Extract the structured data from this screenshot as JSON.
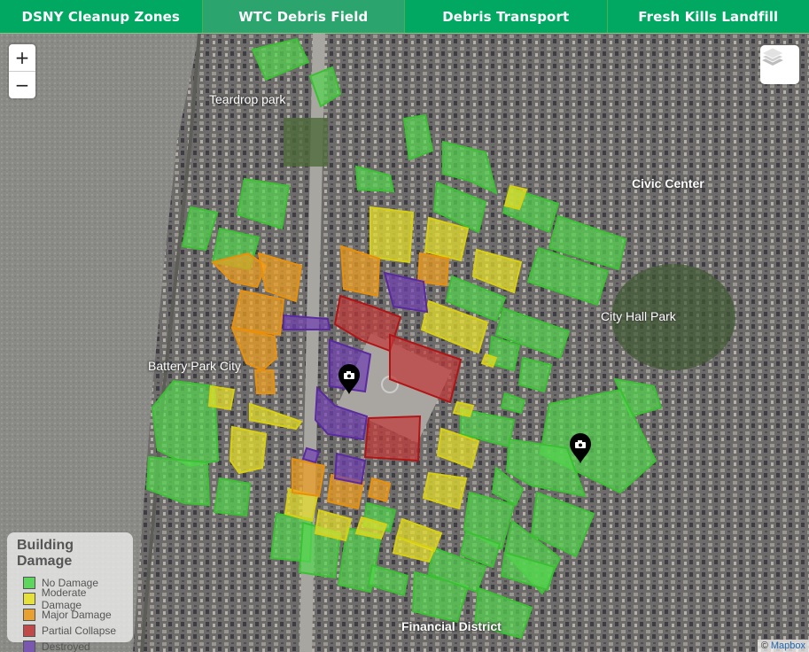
{
  "tabs": [
    {
      "label": "DSNY Cleanup Zones",
      "active": false
    },
    {
      "label": "WTC Debris Field",
      "active": true
    },
    {
      "label": "Debris Transport",
      "active": false
    },
    {
      "label": "Fresh Kills Landfill",
      "active": false
    }
  ],
  "zoom_controls": {
    "zoom_in": "+",
    "zoom_out": "−"
  },
  "layers_button": {
    "icon": "layers-icon"
  },
  "map_labels": [
    {
      "text": "Teardrop park",
      "name": "label-teardrop-park",
      "bold": false
    },
    {
      "text": "Civic Center",
      "name": "label-civic-center",
      "bold": true
    },
    {
      "text": "City Hall Park",
      "name": "label-city-hall-park",
      "bold": false
    },
    {
      "text": "Battery Park City",
      "name": "label-battery-park-city",
      "bold": false
    },
    {
      "text": "Financial District",
      "name": "label-financial-district",
      "bold": true
    }
  ],
  "legend": {
    "title": "Building Damage",
    "items": [
      {
        "label": "No Damage",
        "color": "#5cd65c"
      },
      {
        "label": "Moderate Damage",
        "color": "#e6e03a"
      },
      {
        "label": "Major Damage",
        "color": "#e8a030"
      },
      {
        "label": "Partial Collapse",
        "color": "#c0494a"
      },
      {
        "label": "Destroyed",
        "color": "#7b58b0"
      }
    ]
  },
  "damage_colors": {
    "none": {
      "fill": "#55d44f",
      "stroke": "#3bc033"
    },
    "moderate": {
      "fill": "#e8e02a",
      "stroke": "#d8cf10"
    },
    "major": {
      "fill": "#f0a020",
      "stroke": "#e8900a"
    },
    "partial": {
      "fill": "#c03a3a",
      "stroke": "#b01515"
    },
    "destroyed": {
      "fill": "#7040b0",
      "stroke": "#5a2aa0"
    }
  },
  "markers": [
    {
      "name": "camera-marker-wtc",
      "icon": "camera-icon"
    },
    {
      "name": "camera-marker-east",
      "icon": "camera-icon"
    }
  ],
  "attribution": {
    "prefix": "©",
    "brand": "Mapbox"
  }
}
